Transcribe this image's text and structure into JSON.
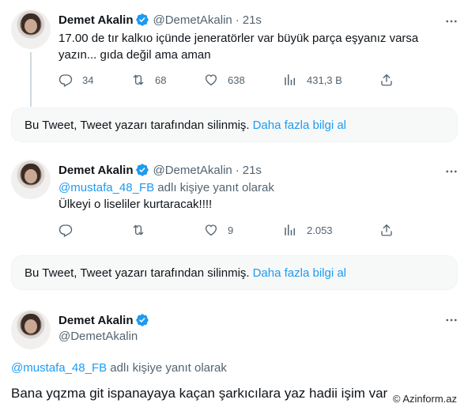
{
  "tweets": [
    {
      "name": "Demet Akalin",
      "handle": "@DemetAkalin",
      "dot": "·",
      "time": "21s",
      "text_line1": "17.00 de tır kalkıo içünde jeneratörler var büyük parça eşyanız varsa",
      "text_line2": "yazın... gıda değil ama aman",
      "stats": {
        "replies": "34",
        "retweets": "68",
        "likes": "638",
        "views": "431,3 B"
      }
    },
    {
      "name": "Demet Akalin",
      "handle": "@DemetAkalin",
      "dot": "·",
      "time": "21s",
      "reply_to": "@mustafa_48_FB",
      "reply_suffix": "adlı kişiye yanıt olarak",
      "text": "Ülkeyi o liseliler kurtaracak!!!!",
      "stats": {
        "replies": "",
        "retweets": "",
        "likes": "9",
        "views": "2.053"
      }
    },
    {
      "name": "Demet Akalin",
      "handle": "@DemetAkalin",
      "reply_to": "@mustafa_48_FB",
      "reply_suffix": "adlı kişiye yanıt olarak",
      "text": "Bana yqzma git ispanayaya kaçan şarkıcılara yaz hadii işim var"
    }
  ],
  "deleted_notice": {
    "text": "Bu Tweet, Tweet yazarı tarafından silinmiş.",
    "link": "Daha fazla bilgi al"
  },
  "watermark": "© Azinform.az",
  "colors": {
    "accent": "#1d9bf0",
    "secondary_text": "#536471",
    "line": "#cfd9de"
  },
  "icons": [
    "verified-badge-icon",
    "more-icon",
    "reply-icon",
    "retweet-icon",
    "like-icon",
    "views-icon",
    "share-icon"
  ]
}
